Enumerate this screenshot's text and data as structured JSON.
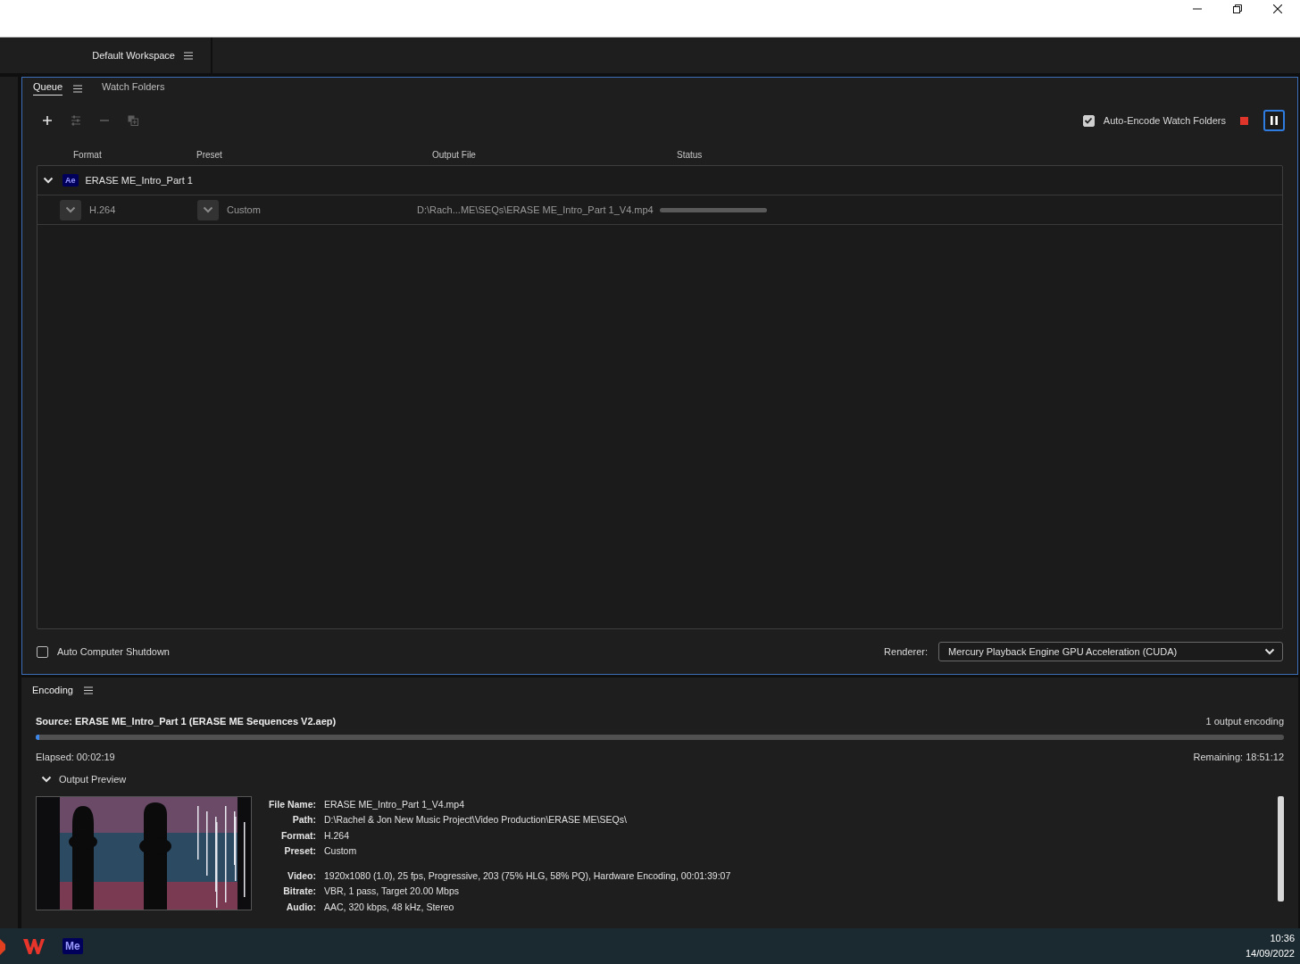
{
  "header": {
    "workspace": "Default Workspace"
  },
  "queue": {
    "tabs": [
      {
        "label": "Queue",
        "selected": true
      },
      {
        "label": "Watch Folders",
        "selected": false
      }
    ],
    "toolbar": [
      {
        "kind": "add",
        "disabled": false
      },
      {
        "kind": "settings",
        "disabled": true
      },
      {
        "kind": "remove",
        "disabled": true
      },
      {
        "kind": "duplicate",
        "disabled": true
      }
    ],
    "auto_encode": {
      "label": "Auto-Encode Watch Folders",
      "checked": true
    },
    "columns": [
      "Format",
      "Preset",
      "Output File",
      "Status"
    ],
    "groups": [
      {
        "badge": "Ae",
        "name": "ERASE ME_Intro_Part 1",
        "expanded": true,
        "outputs": [
          {
            "format": "H.264",
            "preset": "Custom",
            "output_file": "D:\\Rach...ME\\SEQs\\ERASE ME_Intro_Part 1_V4.mp4",
            "level": 1
          }
        ]
      }
    ],
    "auto_shutdown": {
      "label": "Auto Computer Shutdown",
      "checked": false
    },
    "renderer": {
      "label": "Renderer:",
      "value": "Mercury Playback Engine GPU Acceleration (CUDA)"
    }
  },
  "encoding": {
    "title": "Encoding",
    "source": "Source: ERASE ME_Intro_Part 1 (ERASE ME Sequences V2.aep)",
    "count": "1 output encoding",
    "level": 0.003,
    "elapsed": "Elapsed: 00:02:19",
    "remaining": "Remaining: 18:51:12",
    "preview": {
      "label": "Output Preview",
      "expanded": true,
      "details": [
        {
          "label": "File Name:",
          "value": "ERASE ME_Intro_Part 1_V4.mp4"
        },
        {
          "label": "Path:",
          "value": "D:\\Rachel & Jon New Music Project\\Video Production\\ERASE ME\\SEQs\\"
        },
        {
          "label": "Format:",
          "value": "H.264"
        },
        {
          "label": "Preset:",
          "value": "Custom",
          "gap_after": true
        },
        {
          "label": "Video:",
          "value": "1920x1080 (1.0), 25 fps, Progressive, 203 (75% HLG, 58% PQ), Hardware Encoding, 00:01:39:07"
        },
        {
          "label": "Bitrate:",
          "value": "VBR, 1 pass, Target 20.00 Mbps"
        },
        {
          "label": "Audio:",
          "value": "AAC, 320 kbps, 48 kHz, Stereo"
        }
      ]
    }
  },
  "taskbar": {
    "apps": [
      {
        "kind": "partial"
      },
      {
        "kind": "wps"
      },
      {
        "kind": "badge",
        "label": "Me"
      }
    ],
    "time": "10:36",
    "date": "14/09/2022"
  }
}
